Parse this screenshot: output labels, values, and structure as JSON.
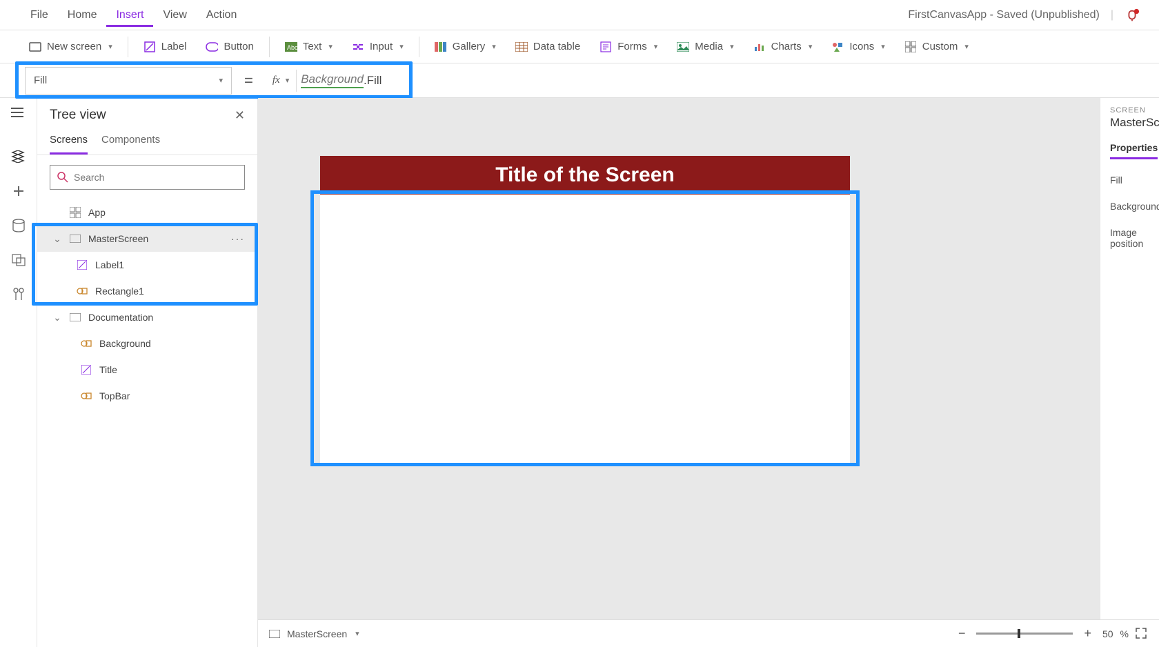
{
  "menu": {
    "file": "File",
    "home": "Home",
    "insert": "Insert",
    "view": "View",
    "action": "Action"
  },
  "app_title": "FirstCanvasApp - Saved (Unpublished)",
  "ribbon": {
    "new_screen": "New screen",
    "label": "Label",
    "button": "Button",
    "text": "Text",
    "input": "Input",
    "gallery": "Gallery",
    "data_table": "Data table",
    "forms": "Forms",
    "media": "Media",
    "charts": "Charts",
    "icons": "Icons",
    "custom": "Custom"
  },
  "formula": {
    "property": "Fill",
    "fx": "fx",
    "ref": "Background",
    "after": ".Fill"
  },
  "tree": {
    "title": "Tree view",
    "tab_screens": "Screens",
    "tab_components": "Components",
    "search_ph": "Search",
    "app": "App",
    "master": "MasterScreen",
    "label1": "Label1",
    "rect1": "Rectangle1",
    "doc": "Documentation",
    "background": "Background",
    "title_node": "Title",
    "topbar": "TopBar"
  },
  "canvas": {
    "screen_title": "Title of the Screen"
  },
  "props": {
    "section": "SCREEN",
    "name": "MasterScreen",
    "tab": "Properties",
    "fill": "Fill",
    "bg": "Background",
    "imgpos": "Image position"
  },
  "status": {
    "screen": "MasterScreen",
    "zoom": "50",
    "pct": "%"
  }
}
